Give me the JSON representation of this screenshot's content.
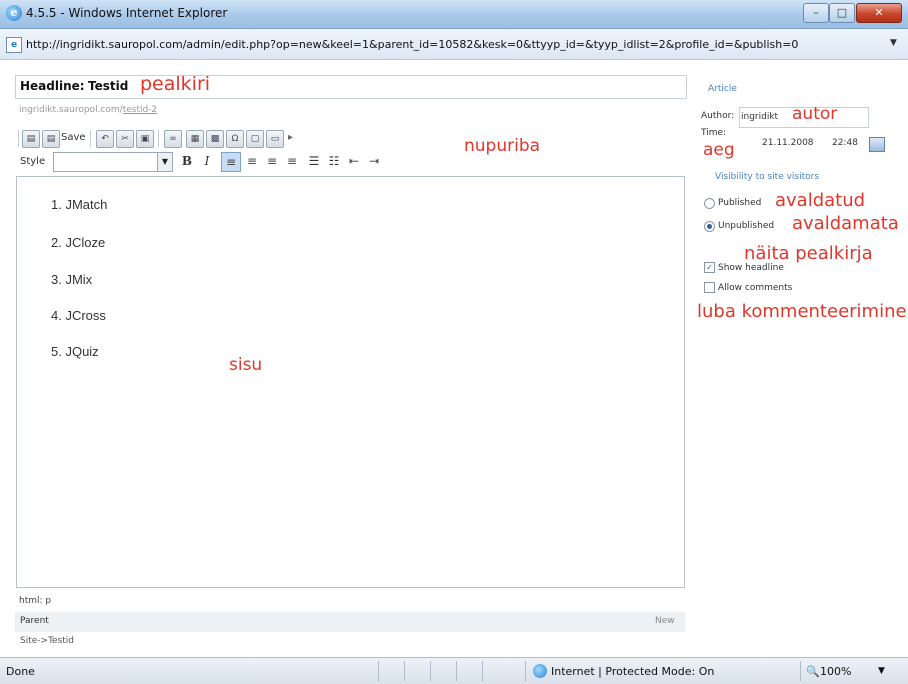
{
  "window": {
    "title": "4.5.5 - Windows Internet Explorer",
    "url": "http://ingridikt.sauropol.com/admin/edit.php?op=new&keel=1&parent_id=10582&kesk=0&ttyyp_id=&tyyp_idlist=2&profile_id=&publish=0"
  },
  "editor": {
    "headline_label": "Headline:",
    "headline_value": "Testid",
    "page_url_base": "ingridikt.sauropol.com/",
    "page_url_link": "testid-2",
    "toolbar": {
      "save_label": "Save",
      "style_label": "Style"
    },
    "content_items": [
      "1. JMatch",
      "2. JCloze",
      "3. JMix",
      "4. JCross",
      "5. JQuiz"
    ],
    "path": "html: p",
    "parent_label": "Parent",
    "parent_new": "New",
    "parent_value": "Site->Testid"
  },
  "sidebar": {
    "article_link": "Article",
    "author_label": "Author:",
    "author_value": "ingridikt",
    "time_label": "Time:",
    "date_value": "21.11.2008",
    "time_value": "22:48",
    "visibility_title": "Visibility to site visitors",
    "published_label": "Published",
    "published_checked": false,
    "unpublished_label": "Unpublished",
    "unpublished_checked": true,
    "show_headline_label": "Show headline",
    "show_headline_checked": true,
    "allow_comments_label": "Allow comments",
    "allow_comments_checked": false
  },
  "annotations": {
    "pealkiri": "pealkiri",
    "nupuriba": "nupuriba",
    "autor": "autor",
    "aeg": "aeg",
    "avaldatud": "avaldatud",
    "avaldamata": "avaldamata",
    "naita_pealkirja": "näita pealkirja",
    "luba_kommenteerimine": "luba kommenteerimine",
    "sisu": "sisu"
  },
  "statusbar": {
    "status": "Done",
    "zone": "Internet | Protected Mode: On",
    "zoom": "100%"
  },
  "colors": {
    "annotation": "#e0362b",
    "link": "#4d82bf",
    "titlebar": "#a9c9ea"
  }
}
